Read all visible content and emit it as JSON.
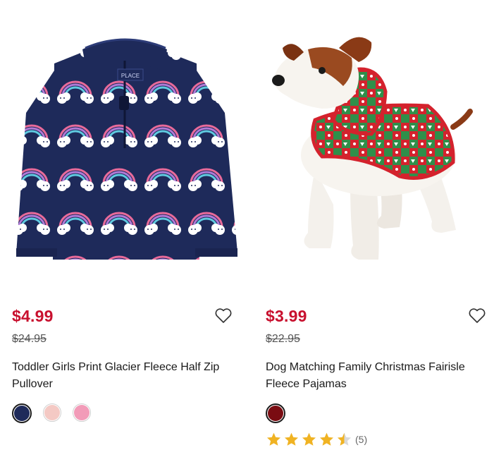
{
  "products": [
    {
      "sale_price": "$4.99",
      "original_price": "$24.95",
      "title": "Toddler Girls Print Glacier Fleece Half Zip Pullover",
      "swatches": [
        {
          "color": "#1e2a5a",
          "selected": true
        },
        {
          "color": "#f4c9c4",
          "selected": false
        },
        {
          "color": "#f29bb8",
          "selected": false
        }
      ],
      "brand_tag": "PLACE"
    },
    {
      "sale_price": "$3.99",
      "original_price": "$22.95",
      "title": "Dog Matching Family Christmas Fairisle Fleece Pajamas",
      "swatches": [
        {
          "color": "#7a0c12",
          "selected": true
        }
      ],
      "rating": {
        "stars": 4.5,
        "count_label": "(5)"
      }
    }
  ],
  "colors": {
    "sale_price": "#c8102e",
    "star": "#f0b323"
  }
}
